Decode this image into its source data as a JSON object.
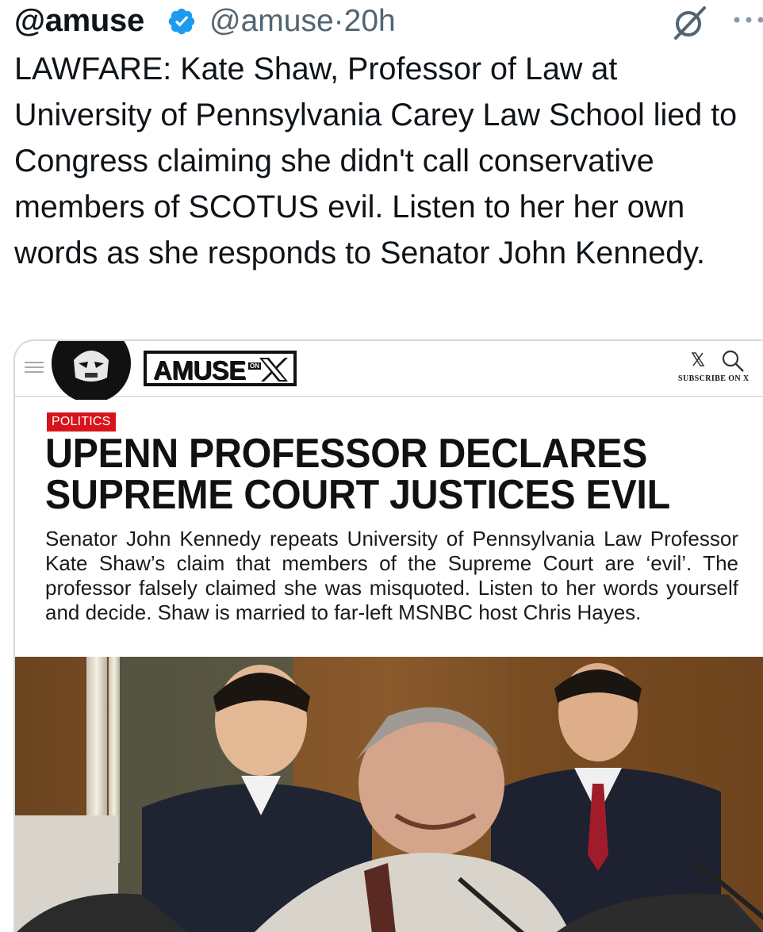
{
  "tweet": {
    "display_name": "@amuse",
    "handle": "@amuse",
    "separator": "·",
    "time": "20h",
    "text": "LAWFARE: Kate Shaw, Professor of Law at University of Pennsylvania Carey Law School lied to Congress claiming she didn't call conservative members of SCOTUS evil. Listen to her her own words as she responds to Senator John Kennedy."
  },
  "icons": {
    "verified": "verified-badge-icon",
    "grok": "grok-slash-icon",
    "more": "more-options-icon",
    "hamburger": "hamburger-menu-icon",
    "search": "search-icon"
  },
  "card": {
    "brand": "AMUSE",
    "brand_on": "ON",
    "subscribe": "SUBSCRIBE ON X",
    "category": "POLITICS",
    "headline_line1": "UPENN PROFESSOR DECLARES",
    "headline_line2": "SUPREME COURT JUSTICES EVIL",
    "dek": "Senator John Kennedy repeats University of Pennsylvania Law Professor Kate Shaw’s claim that members of the Supreme Court are ‘evil’. The professor falsely claimed she was misquoted. Listen to her words yourself and decide. Shaw is married to far-left MSNBC host Chris Hayes."
  },
  "colors": {
    "text": "#0f1419",
    "secondary": "#536471",
    "verified_blue": "#1d9bf0",
    "badge_red": "#d7141a",
    "card_border": "#cfd9de"
  }
}
